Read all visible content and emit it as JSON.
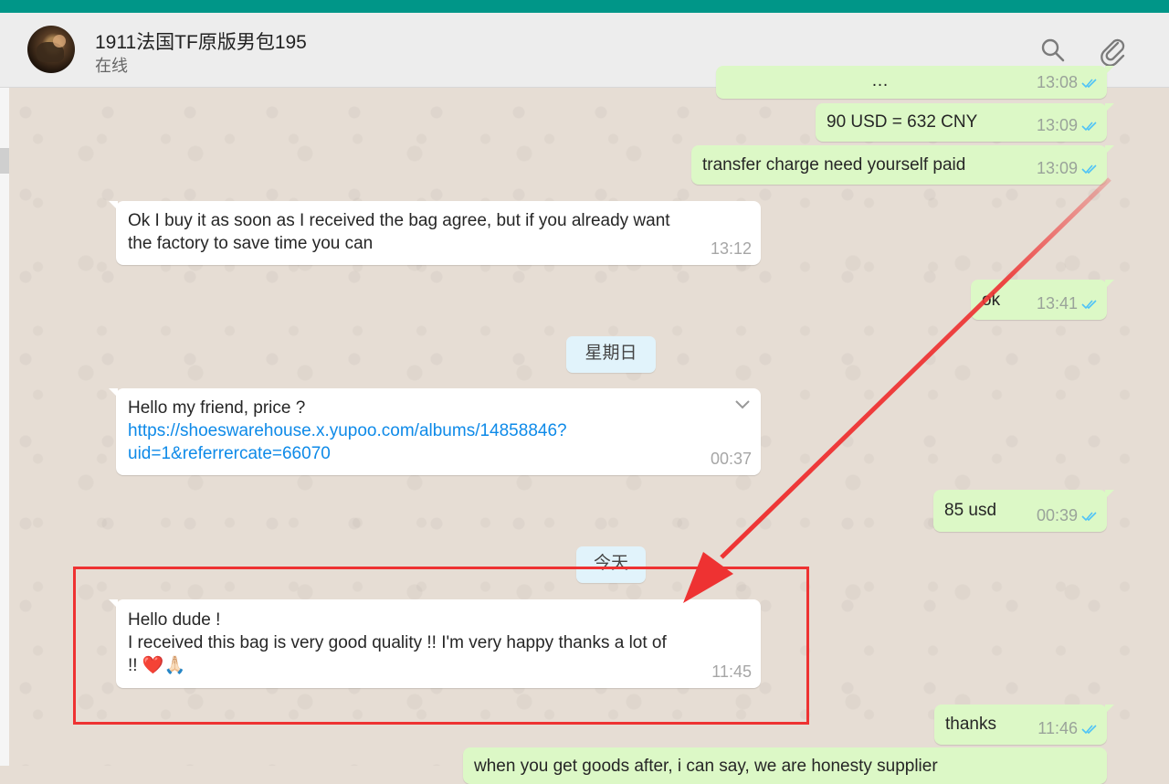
{
  "header": {
    "contact_name": "1911法国TF原版男包195",
    "status": "在线",
    "icons": [
      "search-icon",
      "attach-icon"
    ]
  },
  "messages": [
    {
      "id": "m0",
      "direction": "out",
      "text": "…",
      "time": "13:08"
    },
    {
      "id": "m1",
      "direction": "out",
      "text": "90 USD =  632  CNY",
      "time": "13:09"
    },
    {
      "id": "m2",
      "direction": "out",
      "text": "transfer charge need yourself paid",
      "time": "13:09"
    },
    {
      "id": "m3",
      "direction": "in",
      "text_lines": [
        "Ok I buy it as soon as I received the bag agree, but if you already want",
        "the factory to save time you can"
      ],
      "time": "13:12"
    },
    {
      "id": "m4",
      "direction": "out",
      "text": "ok",
      "time": "13:41"
    },
    {
      "id": "m5",
      "direction": "in",
      "text": "Hello my friend, price ?",
      "link_lines": [
        "https://shoeswarehouse.x.yupoo.com/albums/14858846?",
        "uid=1&referrercate=66070"
      ],
      "time": "00:37"
    },
    {
      "id": "m6",
      "direction": "out",
      "text": "85 usd",
      "time": "00:39"
    },
    {
      "id": "m7",
      "direction": "in",
      "text_lines": [
        "Hello dude !",
        "I received this bag is very good quality !! I'm very happy thanks a lot of",
        "!! ❤️🙏🏻"
      ],
      "time": "11:45"
    },
    {
      "id": "m8",
      "direction": "out",
      "text": "thanks",
      "time": "11:46"
    },
    {
      "id": "m9",
      "direction": "out",
      "text": "when you get goods after, i can say, we are honesty supplier",
      "time": ""
    }
  ],
  "day_separators": [
    "星期日",
    "今天"
  ],
  "colors": {
    "top_bar": "#009688",
    "outgoing_bubble": "#dcf8c6",
    "incoming_bubble": "#ffffff",
    "link": "#0e8ae8",
    "read_ticks": "#4fc3f7",
    "annotation": "#ee3232"
  }
}
